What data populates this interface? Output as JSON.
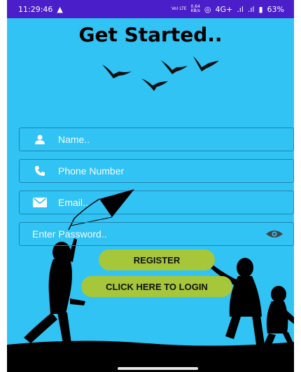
{
  "status": {
    "time": "11:29:46",
    "speed_top": "0.64",
    "speed_unit": "KB/s",
    "volte": "Vo) LTE",
    "network": "4G+",
    "battery": "63%"
  },
  "title": "Get Started..",
  "form": {
    "name_placeholder": "Name..",
    "phone_placeholder": "Phone Number",
    "email_placeholder": "Email..",
    "password_placeholder": "Enter Password.."
  },
  "buttons": {
    "register": "REGISTER",
    "login": "CLICK HERE TO LOGIN"
  },
  "colors": {
    "background": "#31c3f4",
    "status_bar": "#4a1ec9",
    "button": "#a6c73a",
    "field_border": "#1d86ad"
  },
  "icons": {
    "name": "person-icon",
    "phone": "phone-icon",
    "email": "mail-icon",
    "password": "eye-icon"
  }
}
